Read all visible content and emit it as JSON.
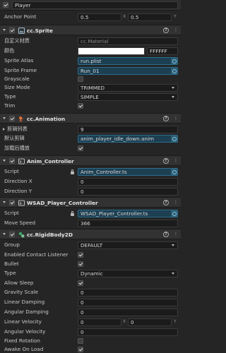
{
  "node": {
    "name": "Player",
    "enabled": true
  },
  "anchor": {
    "label": "Anchor Point",
    "x": "0.5",
    "y": "0.5",
    "x_axis": "X",
    "y_axis": "Y"
  },
  "sprite": {
    "title": "cc.Sprite",
    "custom_material_label": "自定义材质",
    "custom_material": "cc.Material",
    "color_label": "颜色",
    "color_hex": "FFFFFF",
    "color_value": "#FFFFFF",
    "atlas_label": "Sprite Atlas",
    "atlas": "run.plist",
    "frame_label": "Sprite Frame",
    "frame": "Run_01",
    "grayscale_label": "Grayscale",
    "grayscale": false,
    "size_mode_label": "Size Mode",
    "size_mode": "TRIMMED",
    "type_label": "Type",
    "type": "SIMPLE",
    "trim_label": "Trim",
    "trim": true
  },
  "animation": {
    "title": "cc.Animation",
    "clips_label": "剪辑列表",
    "clips_count": "9",
    "default_clip_label": "默认剪辑",
    "default_clip": "anim_player_idle_down.anim",
    "play_on_load_label": "加载后播放",
    "play_on_load": true
  },
  "anim_controller": {
    "title": "Anim_Controller",
    "script_label": "Script",
    "script": "Anim_Controller.ts",
    "dir_x_label": "Direction X",
    "dir_x": "0",
    "dir_y_label": "Direction Y",
    "dir_y": "0"
  },
  "wsad": {
    "title": "WSAD_Player_Controller",
    "script_label": "Script",
    "script": "WSAD_Player_Controller.ts",
    "speed_label": "Move Speed",
    "speed": "366"
  },
  "rigidbody": {
    "title": "cc.RigidBody2D",
    "group_label": "Group",
    "group": "DEFAULT",
    "contact_label": "Enabled Contact Listener",
    "contact": true,
    "bullet_label": "Bullet",
    "bullet": true,
    "type_label": "Type",
    "type": "Dynamic",
    "sleep_label": "Allow Sleep",
    "sleep": true,
    "gravity_label": "Gravity Scale",
    "gravity": "0",
    "lin_damp_label": "Linear Damping",
    "lin_damp": "0",
    "ang_damp_label": "Angular Damping",
    "ang_damp": "0",
    "lin_vel_label": "Linear Velocity",
    "lin_vel_x": "0",
    "lin_vel_y": "0",
    "x_axis": "X",
    "y_axis": "Y",
    "ang_vel_label": "Angular Velocity",
    "ang_vel": "0",
    "fixed_rot_label": "Fixed Rotation",
    "fixed_rot": false,
    "awake_label": "Awake On Load",
    "awake": true
  },
  "icons": {
    "help": "?",
    "menu": "⋮"
  },
  "colors": {
    "asset_bg": "#1d3f52",
    "panel_bg": "#252525",
    "header_bg": "#323232"
  }
}
